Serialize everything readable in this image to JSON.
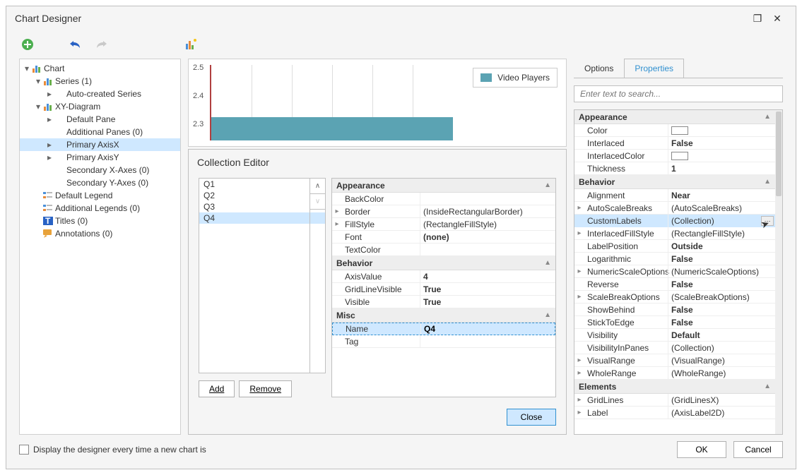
{
  "window": {
    "title": "Chart Designer"
  },
  "tree": {
    "items": [
      {
        "label": "Chart",
        "depth": 0,
        "exp": "▾",
        "icon": "bars"
      },
      {
        "label": "Series (1)",
        "depth": 1,
        "exp": "▾",
        "icon": "bars"
      },
      {
        "label": "Auto-created Series",
        "depth": 2,
        "exp": "▸",
        "icon": null
      },
      {
        "label": "XY-Diagram",
        "depth": 1,
        "exp": "▾",
        "icon": "bars"
      },
      {
        "label": "Default Pane",
        "depth": 2,
        "exp": "▸",
        "icon": null
      },
      {
        "label": "Additional Panes (0)",
        "depth": 2,
        "exp": "",
        "icon": null
      },
      {
        "label": "Primary AxisX",
        "depth": 2,
        "exp": "▸",
        "icon": null,
        "sel": true
      },
      {
        "label": "Primary AxisY",
        "depth": 2,
        "exp": "▸",
        "icon": null
      },
      {
        "label": "Secondary X-Axes (0)",
        "depth": 2,
        "exp": "",
        "icon": null
      },
      {
        "label": "Secondary Y-Axes (0)",
        "depth": 2,
        "exp": "",
        "icon": null
      },
      {
        "label": "Default Legend",
        "depth": 1,
        "exp": "",
        "icon": "legend"
      },
      {
        "label": "Additional Legends (0)",
        "depth": 1,
        "exp": "",
        "icon": "legend"
      },
      {
        "label": "Titles (0)",
        "depth": 1,
        "exp": "",
        "icon": "title"
      },
      {
        "label": "Annotations (0)",
        "depth": 1,
        "exp": "",
        "icon": "anno"
      }
    ]
  },
  "chart": {
    "legend": "Video Players",
    "ticks": [
      "2.5",
      "2.4",
      "2.3"
    ]
  },
  "collection": {
    "title": "Collection Editor",
    "items": [
      "Q1",
      "Q2",
      "Q3",
      "Q4"
    ],
    "selected": 3,
    "add": "Add",
    "remove": "Remove",
    "close": "Close",
    "props": {
      "Appearance": [
        {
          "name": "BackColor",
          "val": "",
          "exp": ""
        },
        {
          "name": "Border",
          "val": "(InsideRectangularBorder)",
          "exp": "▸"
        },
        {
          "name": "FillStyle",
          "val": "(RectangleFillStyle)",
          "exp": "▸"
        },
        {
          "name": "Font",
          "val": "(none)",
          "exp": "",
          "bold": true
        },
        {
          "name": "TextColor",
          "val": "",
          "exp": ""
        }
      ],
      "Behavior": [
        {
          "name": "AxisValue",
          "val": "4",
          "exp": "",
          "bold": true
        },
        {
          "name": "GridLineVisible",
          "val": "True",
          "exp": "",
          "bold": true
        },
        {
          "name": "Visible",
          "val": "True",
          "exp": "",
          "bold": true
        }
      ],
      "Misc": [
        {
          "name": "Name",
          "val": "Q4",
          "exp": "",
          "sel": true,
          "input": true
        },
        {
          "name": "Tag",
          "val": "",
          "exp": ""
        }
      ]
    }
  },
  "right": {
    "tabs": {
      "options": "Options",
      "properties": "Properties"
    },
    "search_ph": "Enter text to search...",
    "props": {
      "Appearance": [
        {
          "name": "Color",
          "val": "",
          "exp": "",
          "sw": true
        },
        {
          "name": "Interlaced",
          "val": "False",
          "exp": "",
          "bold": true
        },
        {
          "name": "InterlacedColor",
          "val": "",
          "exp": "",
          "sw": true
        },
        {
          "name": "Thickness",
          "val": "1",
          "exp": "",
          "bold": true
        }
      ],
      "Behavior": [
        {
          "name": "Alignment",
          "val": "Near",
          "exp": "",
          "bold": true
        },
        {
          "name": "AutoScaleBreaks",
          "val": "(AutoScaleBreaks)",
          "exp": "▸"
        },
        {
          "name": "CustomLabels",
          "val": "(Collection)",
          "exp": "",
          "sel": true,
          "ellipsis": true
        },
        {
          "name": "InterlacedFillStyle",
          "val": "(RectangleFillStyle)",
          "exp": "▸"
        },
        {
          "name": "LabelPosition",
          "val": "Outside",
          "exp": "",
          "bold": true
        },
        {
          "name": "Logarithmic",
          "val": "False",
          "exp": "",
          "bold": true
        },
        {
          "name": "NumericScaleOptions",
          "val": "(NumericScaleOptions)",
          "exp": "▸"
        },
        {
          "name": "Reverse",
          "val": "False",
          "exp": "",
          "bold": true
        },
        {
          "name": "ScaleBreakOptions",
          "val": "(ScaleBreakOptions)",
          "exp": "▸"
        },
        {
          "name": "ShowBehind",
          "val": "False",
          "exp": "",
          "bold": true
        },
        {
          "name": "StickToEdge",
          "val": "False",
          "exp": "",
          "bold": true
        },
        {
          "name": "Visibility",
          "val": "Default",
          "exp": "",
          "bold": true
        },
        {
          "name": "VisibilityInPanes",
          "val": "(Collection)",
          "exp": ""
        },
        {
          "name": "VisualRange",
          "val": "(VisualRange)",
          "exp": "▸"
        },
        {
          "name": "WholeRange",
          "val": "(WholeRange)",
          "exp": "▸"
        }
      ],
      "Elements": [
        {
          "name": "GridLines",
          "val": "(GridLinesX)",
          "exp": "▸"
        },
        {
          "name": "Label",
          "val": "(AxisLabel2D)",
          "exp": "▸"
        }
      ]
    }
  },
  "footer": {
    "checkbox": "Display the designer every time a new chart is",
    "ok": "OK",
    "cancel": "Cancel"
  }
}
